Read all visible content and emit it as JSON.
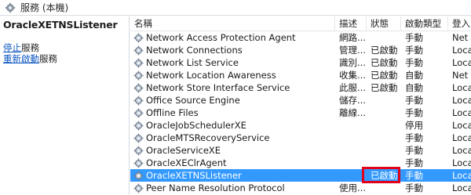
{
  "window": {
    "title": "服務 (本機)"
  },
  "left_pane": {
    "service_name": "OracleXETNSListener",
    "actions": [
      {
        "link": "停止",
        "rest": "服務"
      },
      {
        "link": "重新啟動",
        "rest": "服務"
      }
    ]
  },
  "columns": {
    "name": "名稱",
    "description": "描述",
    "status": "狀態",
    "startup_type": "啟動類型",
    "logon_as": "登入"
  },
  "services": [
    {
      "name": "Network Access Protection Agent",
      "description": "網路...",
      "status": "",
      "startup": "手動",
      "logon": "Net"
    },
    {
      "name": "Network Connections",
      "description": "管理...",
      "status": "已啟動",
      "startup": "手動",
      "logon": "Loca"
    },
    {
      "name": "Network List Service",
      "description": "識別...",
      "status": "已啟動",
      "startup": "手動",
      "logon": "Loca"
    },
    {
      "name": "Network Location Awareness",
      "description": "收集...",
      "status": "已啟動",
      "startup": "自動",
      "logon": "Net"
    },
    {
      "name": "Network Store Interface Service",
      "description": "此服...",
      "status": "已啟動",
      "startup": "自動",
      "logon": "Loca"
    },
    {
      "name": "Office Source Engine",
      "description": "儲存...",
      "status": "",
      "startup": "手動",
      "logon": "Loca"
    },
    {
      "name": "Offline Files",
      "description": "離線...",
      "status": "",
      "startup": "手動",
      "logon": "Loca"
    },
    {
      "name": "OracleJobSchedulerXE",
      "description": "",
      "status": "",
      "startup": "停用",
      "logon": "Loca"
    },
    {
      "name": "OracleMTSRecoveryService",
      "description": "",
      "status": "",
      "startup": "手動",
      "logon": "Loca"
    },
    {
      "name": "OracleServiceXE",
      "description": "",
      "status": "",
      "startup": "手動",
      "logon": "Loca"
    },
    {
      "name": "OracleXEClrAgent",
      "description": "",
      "status": "",
      "startup": "手動",
      "logon": "Loca"
    },
    {
      "name": "OracleXETNSListener",
      "description": "",
      "status": "已啟動",
      "startup": "手動",
      "logon": "Loca",
      "selected": true
    },
    {
      "name": "Peer Name Resolution Protocol",
      "description": "使用...",
      "status": "",
      "startup": "手動",
      "logon": "Loca"
    }
  ],
  "colors": {
    "selection": "#3399ff",
    "highlight_box": "#e2001a",
    "link": "#0b57c2"
  },
  "icons": {
    "title_icon": "gear-icon",
    "row_icon": "service-gear-icon"
  }
}
